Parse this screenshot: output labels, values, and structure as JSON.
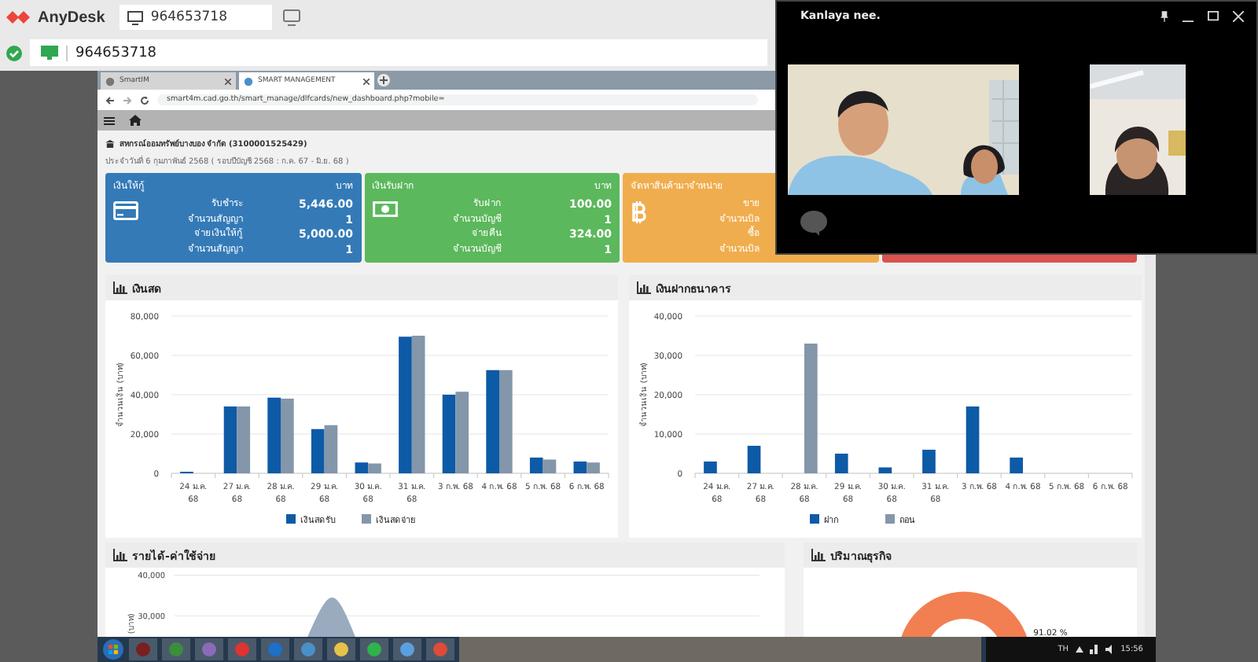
{
  "app": {
    "name": "AnyDesk"
  },
  "session_tab": {
    "label": "964653718",
    "selected": true
  },
  "address_bar": {
    "value": "964653718"
  },
  "browser": {
    "tabs": [
      {
        "label": "SmartIM",
        "selected": false
      },
      {
        "label": "SMART MANAGEMENT",
        "selected": true
      }
    ],
    "url": "smart4m.cad.go.th/smart_manage/dlfcards/new_dashboard.php?mobile="
  },
  "page": {
    "org": "สหกรณ์ออมทรัพย์บางบอง จำกัด (3100001525429)",
    "date_line": "ประจำวันที่ 6 กุมภาพันธ์ 2568 ( รอบปีบัญชี 2568 : ก.ค. 67 - มิ.ย. 68 )"
  },
  "cards": [
    {
      "title": "เงินให้กู้",
      "unit": "บาท",
      "color": "#337ab7",
      "rows": [
        {
          "label": "รับชำระ",
          "value": "5,446.00"
        },
        {
          "label": "จำนวนสัญญา",
          "value": "1"
        },
        {
          "label": "จ่ายเงินให้กู้",
          "value": "5,000.00"
        },
        {
          "label": "จำนวนสัญญา",
          "value": "1"
        }
      ]
    },
    {
      "title": "เงินรับฝาก",
      "unit": "บาท",
      "color": "#5cb85c",
      "rows": [
        {
          "label": "รับฝาก",
          "value": "100.00"
        },
        {
          "label": "จำนวนบัญชี",
          "value": "1"
        },
        {
          "label": "จ่ายคืน",
          "value": "324.00"
        },
        {
          "label": "จำนวนบัญชี",
          "value": "1"
        }
      ]
    },
    {
      "title": "จัดหาสินค้ามาจำหน่าย",
      "color": "#f0ad4e",
      "rows": [
        {
          "label": "ขาย"
        },
        {
          "label": "จำนวนบิล"
        },
        {
          "label": "ซื้อ"
        },
        {
          "label": "จำนวนบิล"
        }
      ]
    },
    {
      "color": "#d9534f"
    }
  ],
  "charts": [
    {
      "title": "เงินสด",
      "chart_data": {
        "type": "bar",
        "ylabel": "จำนวนเงิน (บาท)",
        "categories": [
          "24 ม.ค. 68",
          "27 ม.ค. 68",
          "28 ม.ค. 68",
          "29 ม.ค. 68",
          "30 ม.ค. 68",
          "31 ม.ค. 68",
          "3 ก.พ. 68",
          "4 ก.พ. 68",
          "5 ก.พ. 68",
          "6 ก.พ. 68"
        ],
        "series": [
          {
            "name": "เงินสดรับ",
            "color": "#0d5aa7",
            "values": [
              800,
              34000,
              38500,
              22500,
              5500,
              69500,
              40000,
              52500,
              8000,
              6000
            ]
          },
          {
            "name": "เงินสดจ่าย",
            "color": "#8496aa",
            "values": [
              0,
              34000,
              38000,
              24500,
              5000,
              70000,
              41500,
              52500,
              7000,
              5500
            ]
          }
        ],
        "grid": true,
        "legend": "bottom",
        "ylim": [
          0,
          80000
        ],
        "yticks": [
          {
            "value": 0,
            "label": "0"
          },
          {
            "value": 20000,
            "label": "20,000"
          },
          {
            "value": 40000,
            "label": "40,000"
          },
          {
            "value": 60000,
            "label": "60,000"
          },
          {
            "value": 80000,
            "label": "80,000"
          }
        ]
      }
    },
    {
      "title": "เงินฝากธนาคาร",
      "chart_data": {
        "type": "bar",
        "ylabel": "จำนวนเงิน (บาท)",
        "categories": [
          "24 ม.ค. 68",
          "27 ม.ค. 68",
          "28 ม.ค. 68",
          "29 ม.ค. 68",
          "30 ม.ค. 68",
          "31 ม.ค. 68",
          "3 ก.พ. 68",
          "4 ก.พ. 68",
          "5 ก.พ. 68",
          "6 ก.พ. 68"
        ],
        "series": [
          {
            "name": "ฝาก",
            "color": "#0d5aa7",
            "values": [
              3000,
              7000,
              0,
              5000,
              1500,
              6000,
              17000,
              4000,
              0,
              0
            ]
          },
          {
            "name": "ถอน",
            "color": "#8496aa",
            "values": [
              0,
              0,
              33000,
              0,
              0,
              0,
              0,
              0,
              0,
              0
            ]
          }
        ],
        "grid": true,
        "legend": "bottom",
        "ylim": [
          0,
          40000
        ],
        "yticks": [
          {
            "value": 0,
            "label": "0"
          },
          {
            "value": 10000,
            "label": "10,000"
          },
          {
            "value": 20000,
            "label": "20,000"
          },
          {
            "value": 30000,
            "label": "30,000"
          },
          {
            "value": 40000,
            "label": "40,000"
          }
        ]
      }
    }
  ],
  "bottom_panels": [
    {
      "kind": "area",
      "title": "รายได้-ค่าใช้จ่าย",
      "tick_labels": [
        "40,000",
        "30,000"
      ],
      "axis_label": "(บาท)"
    },
    {
      "kind": "donut",
      "title": "ปริมาณธุรกิจ",
      "value_label": "91.02 %"
    }
  ],
  "video_call": {
    "title": "Kanlaya nee."
  },
  "taskbar": {
    "language": "TH",
    "clock": "15:56"
  }
}
